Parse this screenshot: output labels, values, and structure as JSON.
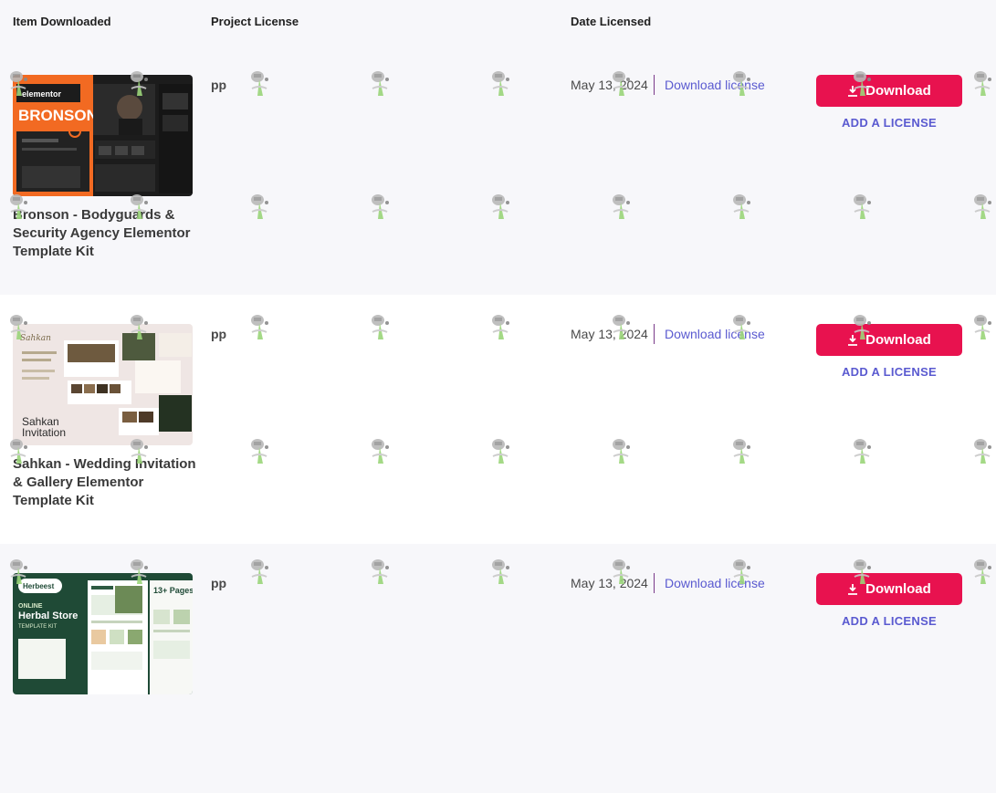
{
  "header": {
    "col_item": "Item Downloaded",
    "col_project": "Project License",
    "col_date": "Date Licensed"
  },
  "rows": [
    {
      "title": "Bronson - Bodyguards & Security Agency Elementor Template Kit",
      "thumb_text": "BRONSON",
      "thumb_brand": "elementor",
      "project": "pp",
      "date": "May 13, 2024",
      "link": "Download license",
      "download": "Download",
      "add_license": "ADD A LICENSE"
    },
    {
      "title": "Sahkan - Wedding Invitation & Gallery Elementor Template Kit",
      "thumb_text": "Sahkan Invitation",
      "thumb_brand": "Sahkan",
      "project": "pp",
      "date": "May 13, 2024",
      "link": "Download license",
      "download": "Download",
      "add_license": "ADD A LICENSE"
    },
    {
      "title": "",
      "thumb_text": "Herbal Store",
      "thumb_brand": "Herbeest",
      "thumb_sub": "ONLINE",
      "thumb_kit": "TEMPLATE KIT",
      "thumb_pages": "13+ Pages",
      "project": "pp",
      "date": "May 13, 2024",
      "link": "Download license",
      "download": "Download",
      "add_license": "ADD A LICENSE"
    }
  ],
  "colors": {
    "accent": "#e8124f",
    "link": "#5a5ad0",
    "bronson_orange": "#f26a22",
    "herbal_green": "#1f4a36"
  },
  "icons": [
    "download-icon",
    "watermark-icon"
  ]
}
